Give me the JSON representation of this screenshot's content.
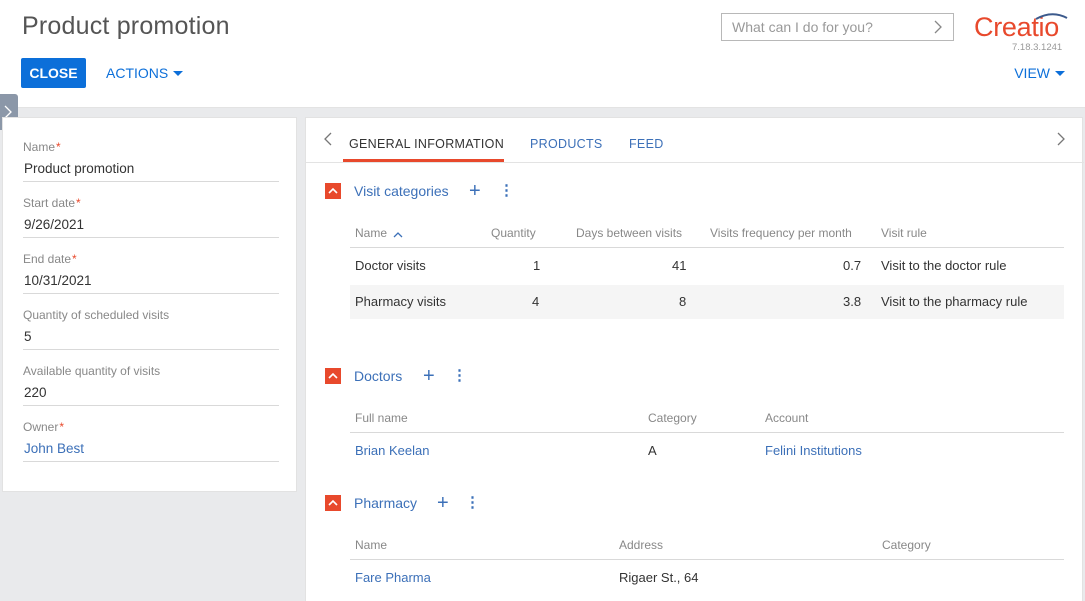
{
  "header": {
    "title": "Product promotion",
    "close_label": "CLOSE",
    "actions_label": "ACTIONS",
    "view_label": "VIEW",
    "search_placeholder": "What can I do for you?",
    "logo_text": "Creatio",
    "version": "7.18.3.1241"
  },
  "fields": [
    {
      "label": "Name",
      "required": true,
      "value": "Product promotion"
    },
    {
      "label": "Start date",
      "required": true,
      "value": "9/26/2021"
    },
    {
      "label": "End date",
      "required": true,
      "value": "10/31/2021"
    },
    {
      "label": "Quantity of scheduled visits",
      "required": false,
      "value": "5"
    },
    {
      "label": "Available quantity of visits",
      "required": false,
      "value": "220"
    },
    {
      "label": "Owner",
      "required": true,
      "value": "John Best"
    }
  ],
  "tabs": [
    {
      "label": "GENERAL INFORMATION"
    },
    {
      "label": "PRODUCTS"
    },
    {
      "label": "FEED"
    }
  ],
  "visit_categories": {
    "title": "Visit categories",
    "columns": [
      "Name",
      "Quantity",
      "Days between visits",
      "Visits frequency per month",
      "Visit rule"
    ],
    "rows": [
      [
        "Doctor visits",
        "1",
        "41",
        "0.7",
        "Visit to the doctor rule"
      ],
      [
        "Pharmacy visits",
        "4",
        "8",
        "3.8",
        "Visit to the pharmacy rule"
      ]
    ]
  },
  "doctors": {
    "title": "Doctors",
    "columns": [
      "Full name",
      "Category",
      "Account"
    ],
    "rows": [
      [
        "Brian Keelan",
        "A",
        "Felini Institutions"
      ]
    ]
  },
  "pharmacy": {
    "title": "Pharmacy",
    "columns": [
      "Name",
      "Address",
      "Category"
    ],
    "rows": [
      [
        "Fare Pharma",
        "Rigaer St., 64",
        ""
      ]
    ]
  },
  "colors": {
    "accent": "#0c6fd9",
    "brand": "#e8492c",
    "link": "#3c70b8"
  }
}
